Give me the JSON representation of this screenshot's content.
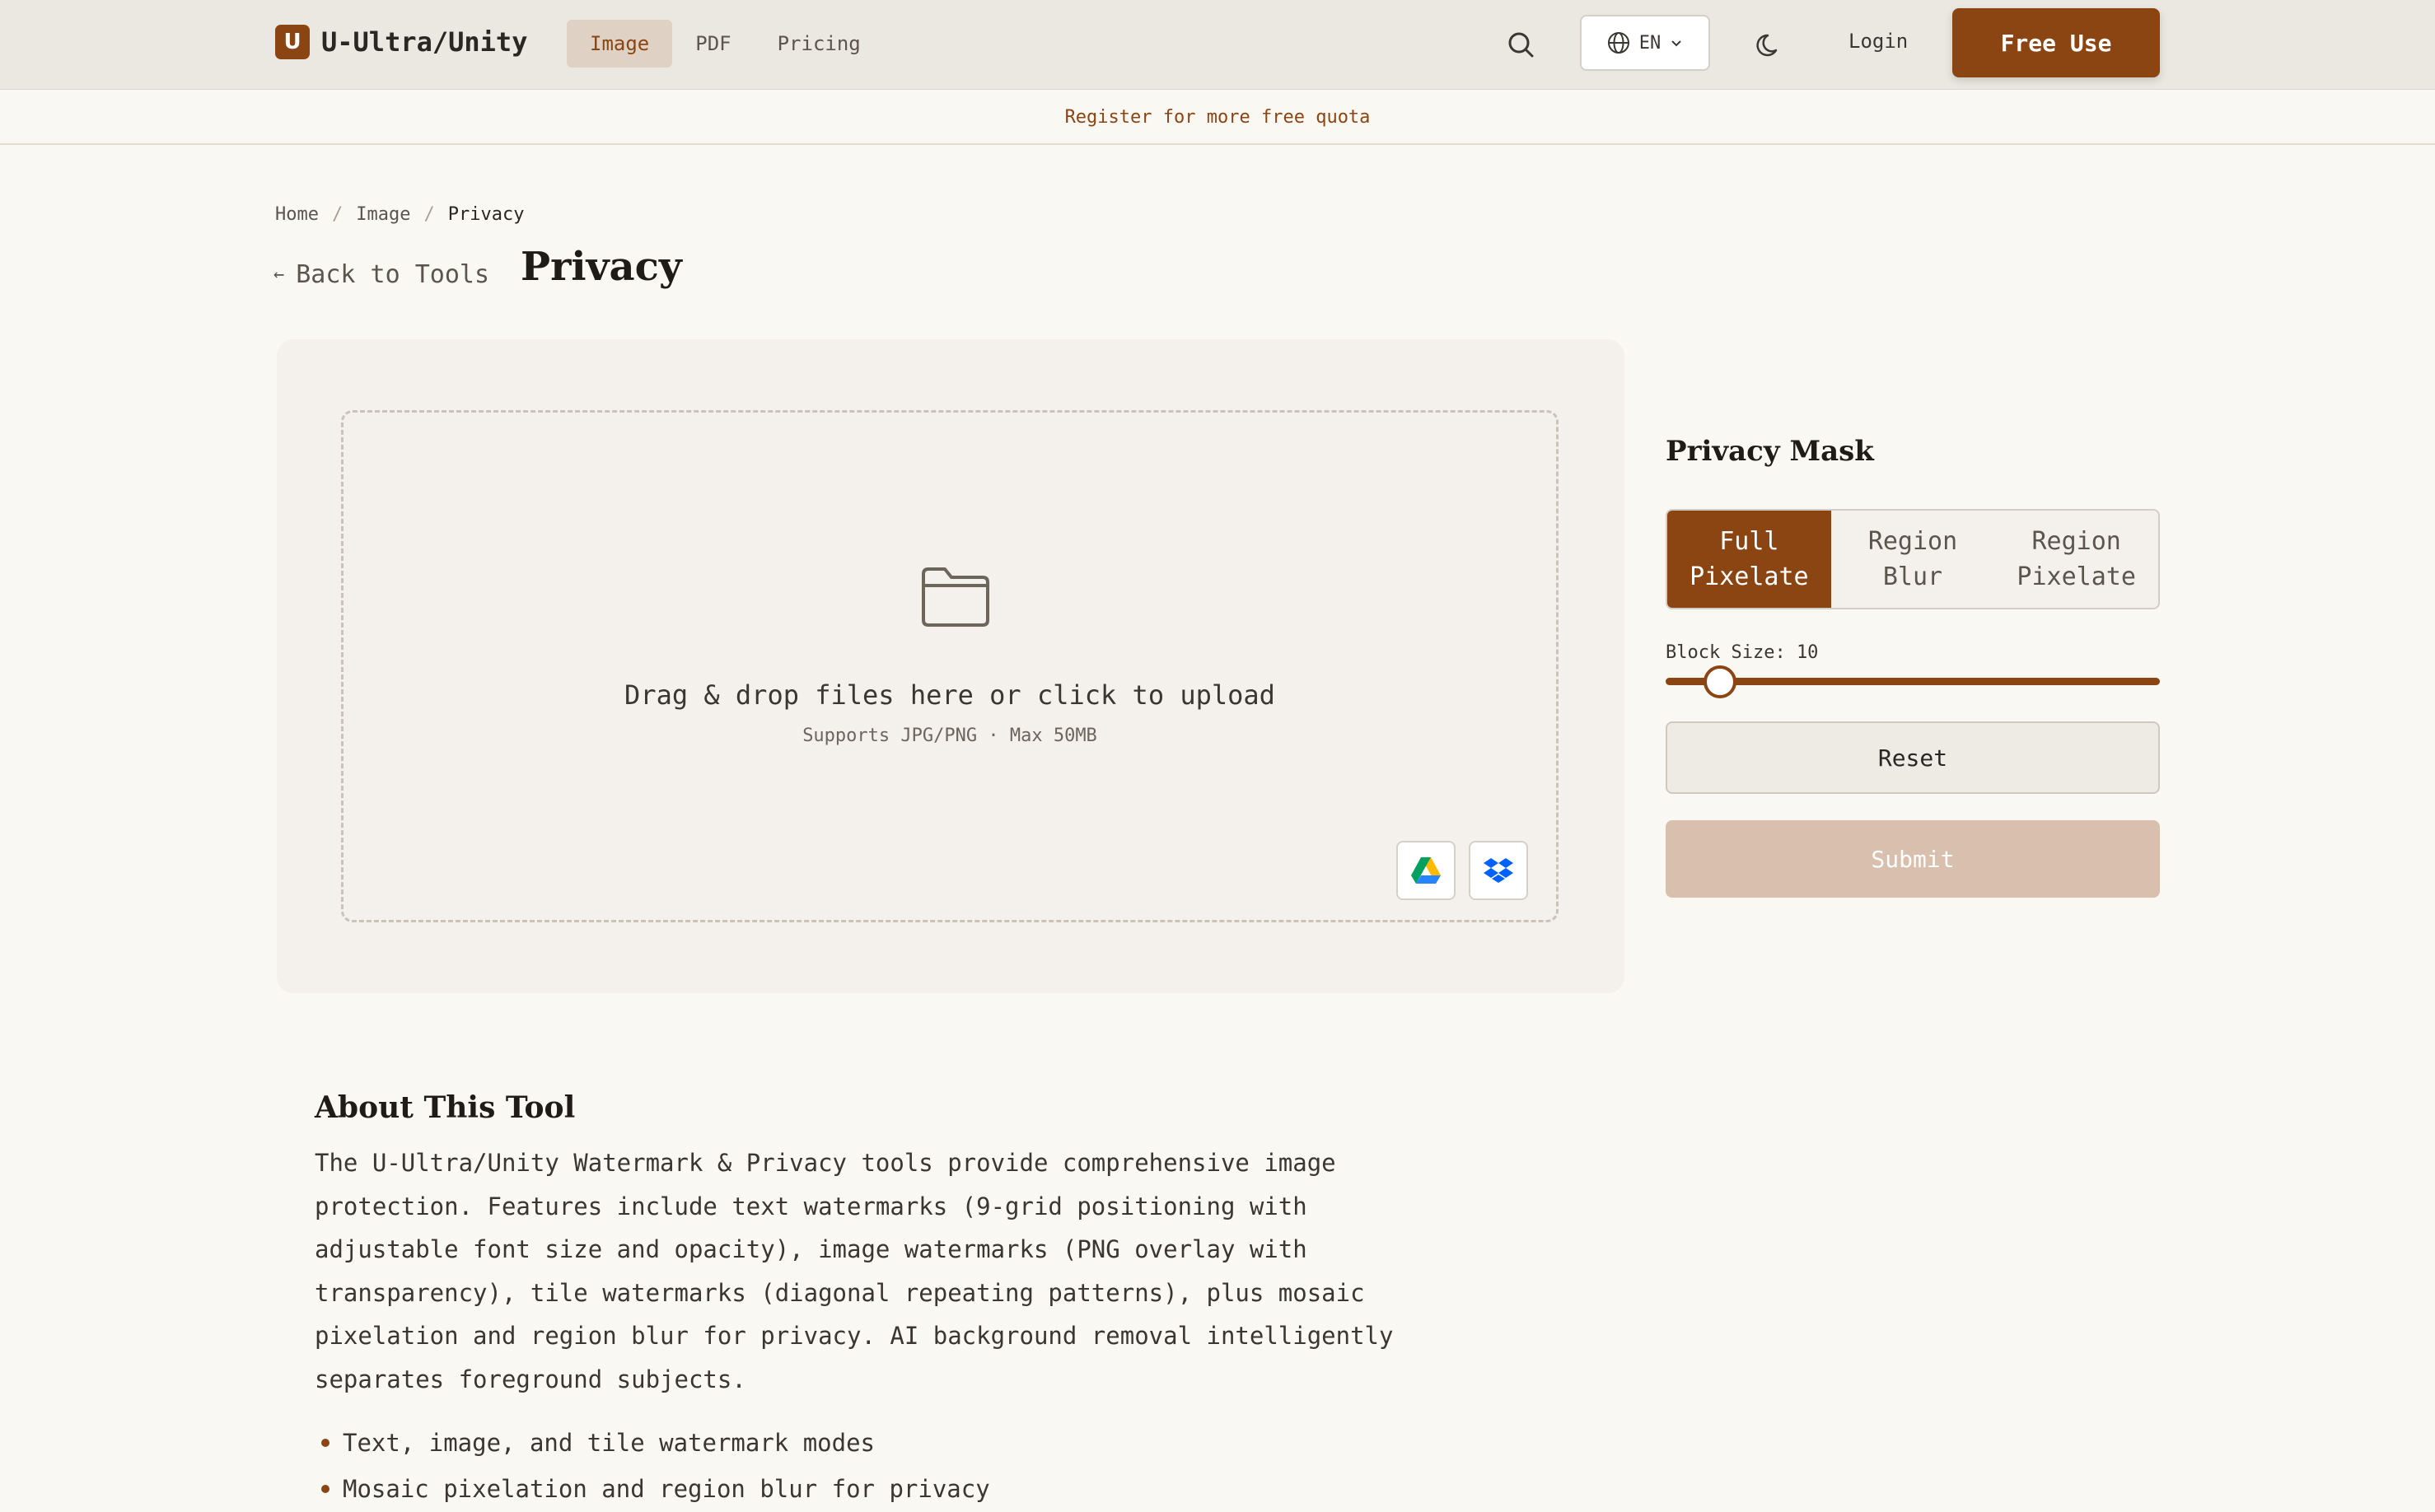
{
  "header": {
    "logo_letter": "U",
    "brand": "U-Ultra/Unity",
    "nav": [
      {
        "label": "Image",
        "active": true
      },
      {
        "label": "PDF",
        "active": false
      },
      {
        "label": "Pricing",
        "active": false
      }
    ],
    "search_icon": "search-icon",
    "language": "EN",
    "language_icon": "globe-icon",
    "theme_icon": "moon-icon",
    "login": "Login",
    "cta": "Free Use"
  },
  "banner": "Register for more free quota",
  "breadcrumb": [
    "Home",
    "Image",
    "Privacy"
  ],
  "back_label": "Back to Tools",
  "page_title": "Privacy",
  "upload": {
    "icon": "folder-icon",
    "prompt": "Drag & drop files here or click to upload",
    "sub": "Supports JPG/PNG · Max 50MB",
    "sources": [
      "google-drive-icon",
      "dropbox-icon"
    ]
  },
  "panel": {
    "title": "Privacy Mask",
    "modes": [
      {
        "line1": "Full",
        "line2": "Pixelate",
        "active": true
      },
      {
        "line1": "Region",
        "line2": "Blur",
        "active": false
      },
      {
        "line1": "Region",
        "line2": "Pixelate",
        "active": false
      }
    ],
    "slider": {
      "label": "Block Size: 10",
      "value_fraction": 0.11
    },
    "reset": "Reset",
    "submit": "Submit"
  },
  "about": {
    "title": "About This Tool",
    "body": "The U-Ultra/Unity Watermark & Privacy tools provide comprehensive image protection. Features include text watermarks (9-grid positioning with adjustable font size and opacity), image watermarks (PNG overlay with transparency), tile watermarks (diagonal repeating patterns), plus mosaic pixelation and region blur for privacy. AI background removal intelligently separates foreground subjects.",
    "bullets": [
      "Text, image, and tile watermark modes",
      "Mosaic pixelation and region blur for privacy"
    ]
  },
  "colors": {
    "accent": "#8b4513",
    "background": "#faf8f3",
    "header": "#ebe8e1",
    "submit_disabled": "#d9bfae"
  }
}
